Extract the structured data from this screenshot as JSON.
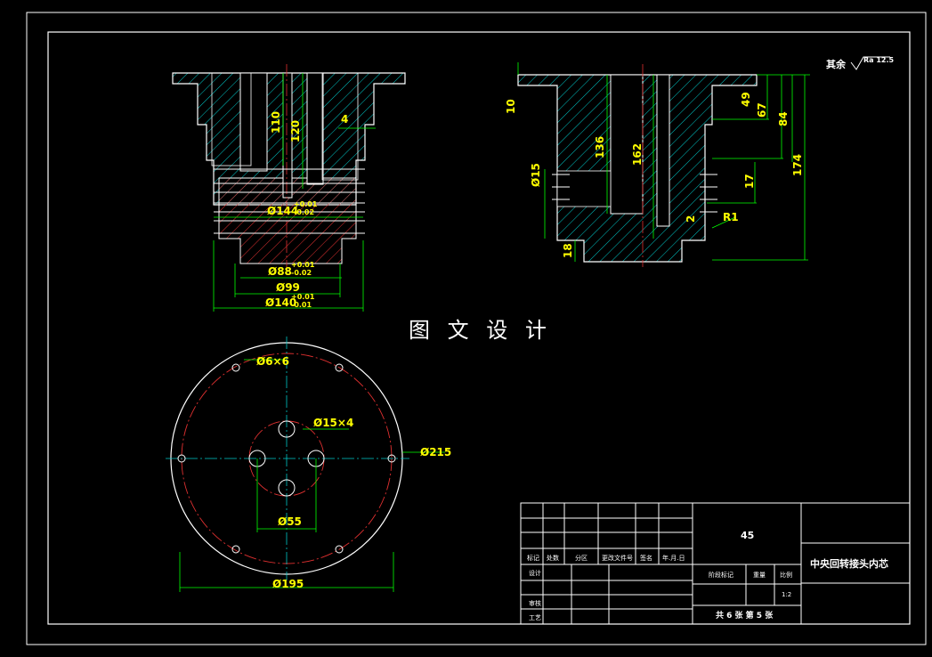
{
  "watermark": "图 文 设 计",
  "surface_note": {
    "prefix": "其余",
    "value": "Ra 12.5"
  },
  "front_view": {
    "dims": {
      "d110": "110",
      "d120": "120",
      "d4": "4",
      "d144": "Ø144",
      "d144_tol_up": "+0.01",
      "d144_tol_lo": "-0.02",
      "d88": "Ø88",
      "d88_tol_up": "+0.01",
      "d88_tol_lo": "-0.02",
      "d99": "Ø99",
      "d140": "Ø140",
      "d140_tol_up": "+0.01",
      "d140_tol_lo": "-0.01"
    }
  },
  "section_view": {
    "dims": {
      "d10": "10",
      "d136": "136",
      "d162": "162",
      "d49": "49",
      "d67": "67",
      "d84": "84",
      "d174": "174",
      "d15": "Ø15",
      "d17": "17",
      "d2": "2",
      "r1": "R1",
      "d18": "18"
    }
  },
  "top_view": {
    "dims": {
      "holes6": "Ø6×6",
      "holes15": "Ø15×4",
      "d215": "Ø215",
      "d55": "Ø55",
      "d195": "Ø195"
    }
  },
  "title_block": {
    "material": "45",
    "part_name": "中央回转接头内芯",
    "labels": {
      "mark": "标记",
      "count": "处数",
      "zone": "分区",
      "change_doc": "更改文件号",
      "sign": "签名",
      "date": "年.月.日",
      "design": "设计",
      "review": "审核",
      "process": "工艺",
      "stage_mark": "阶段标记",
      "weight": "重量",
      "scale": "比例"
    },
    "scale_value": "1:2",
    "sheet_info": "共 6 张   第 5 张"
  }
}
